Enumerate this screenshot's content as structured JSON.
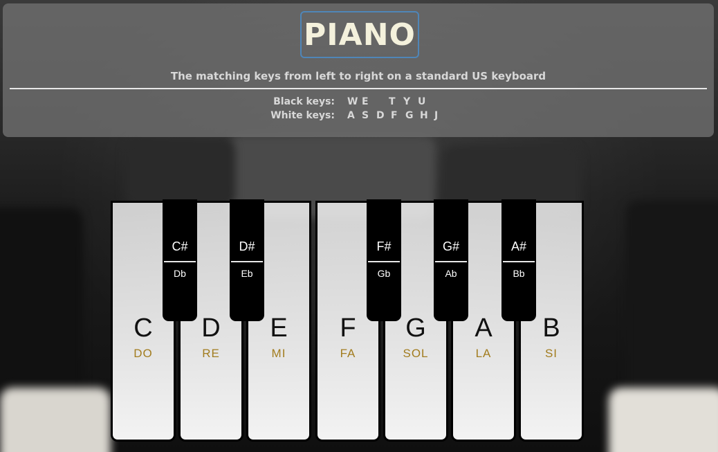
{
  "header": {
    "title": "PIANO",
    "subtitle": "The matching keys from left to right on a standard US keyboard",
    "black_keys_label": "Black keys:",
    "white_keys_label": "White keys:",
    "black_keys": [
      "W",
      "E",
      "T",
      "Y",
      "U"
    ],
    "white_keys": [
      "A",
      "S",
      "D",
      "F",
      "G",
      "H",
      "J"
    ]
  },
  "piano": {
    "white_keys": [
      {
        "note": "C",
        "solfege": "DO"
      },
      {
        "note": "D",
        "solfege": "RE"
      },
      {
        "note": "E",
        "solfege": "MI"
      },
      {
        "note": "F",
        "solfege": "FA"
      },
      {
        "note": "G",
        "solfege": "SOL"
      },
      {
        "note": "A",
        "solfege": "LA"
      },
      {
        "note": "B",
        "solfege": "SI"
      }
    ],
    "black_keys": [
      {
        "sharp": "C#",
        "flat": "Db"
      },
      {
        "sharp": "D#",
        "flat": "Eb"
      },
      {
        "sharp": "F#",
        "flat": "Gb"
      },
      {
        "sharp": "G#",
        "flat": "Ab"
      },
      {
        "sharp": "A#",
        "flat": "Bb"
      }
    ]
  },
  "colors": {
    "solfege": "#a27c1e",
    "title": "#f4f1dc",
    "title_border": "#4f86b8"
  }
}
